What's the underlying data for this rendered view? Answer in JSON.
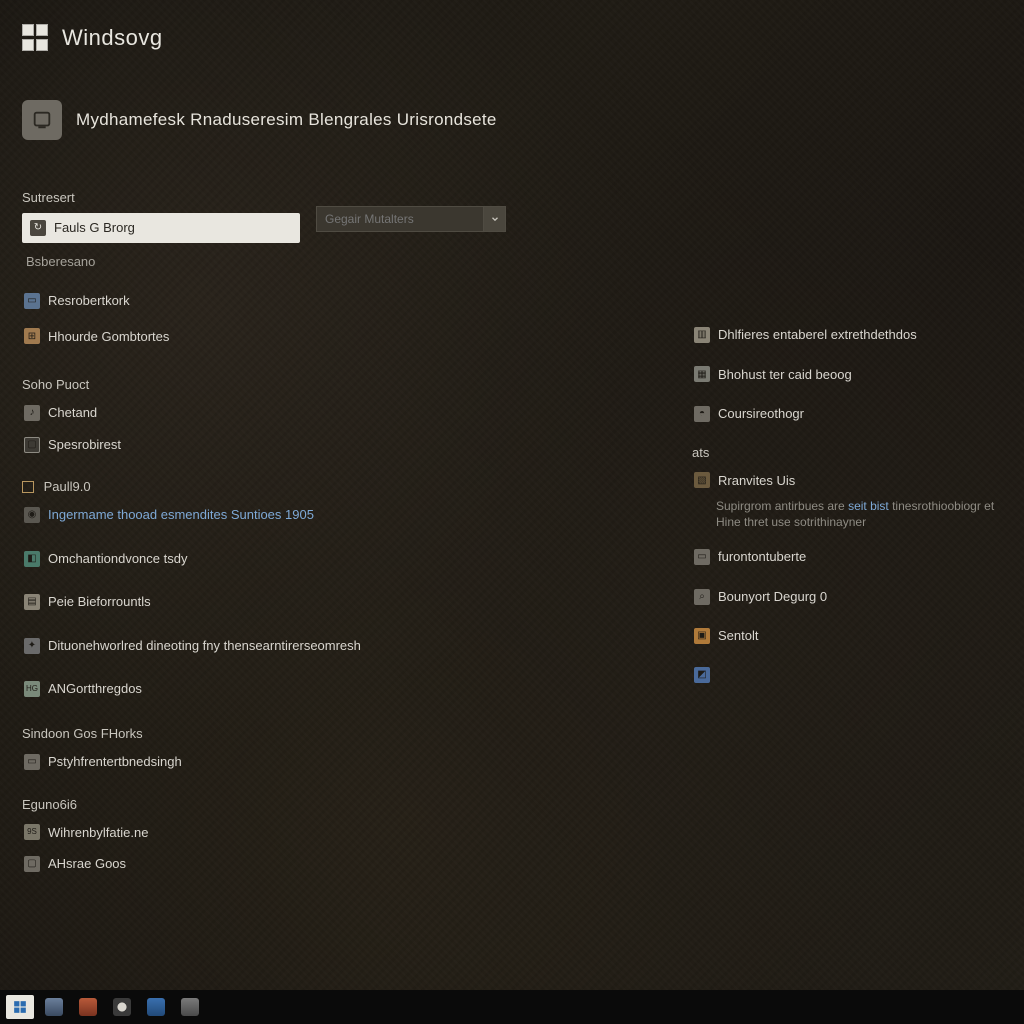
{
  "brand": "Windsovg",
  "page_title": "Mydhamefesk Rnaduseresim Blengrales Urisrondsete",
  "search": {
    "placeholder": "Gegair Mutalters"
  },
  "left": {
    "section1_label": "Sutresert",
    "selected_item": "Fauls G Brorg",
    "item_after_selected": "Bsberesano",
    "network_item": "Resrobertkork",
    "devices_item": "Hhourde Gombtortes",
    "section2_label": "Soho Puoct",
    "s2_item1": "Chetand",
    "s2_item2": "Spesrobirest",
    "section3_label": "Paull9.0",
    "s3_link": "Ingermame thooad esmendites Suntioes 1905",
    "s3_item2": "Omchantiondvonce tsdy",
    "s3_item3": "Peie Bieforrountls",
    "s3_item4_text": "Dituonehworlred dineoting fny thensearntirerseomresh",
    "s3_item5": "ANGortthregdos",
    "section4_label": "Sindoon Gos FHorks",
    "s4_item1": "Pstyhfrentertbnedsingh",
    "section5_label": "Eguno6i6",
    "s5_item1": "Wihrenbylfatie.ne",
    "s5_item2": "AHsrae Goos"
  },
  "right": {
    "r1": "Dhlfieres entaberel extrethdethdos",
    "r2": "Bhohust ter caid beoog",
    "r3": "Coursireothogr",
    "r_section_label": "ats",
    "r4_title": "Rranvites Uis",
    "r4_sub_pre": "Supirgrom antirbues are ",
    "r4_sub_link": "seit bist",
    "r4_sub_post": " tinesrothioobiogr et Hine thret use sotrithinayner",
    "r5": "furontontuberte",
    "r6": "Bounyort Degurg 0",
    "r7": "Sentolt"
  },
  "taskbar": {
    "apps": [
      "start",
      "explorer",
      "media",
      "clock",
      "browser",
      "settings"
    ]
  }
}
